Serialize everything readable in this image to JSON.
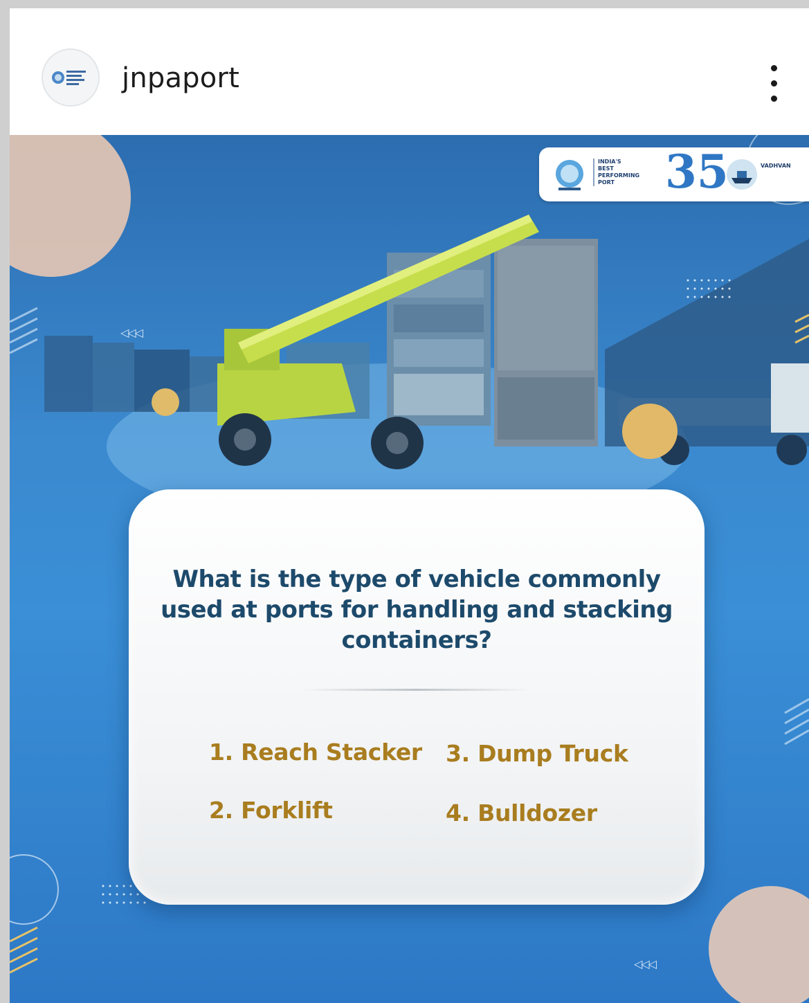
{
  "header": {
    "username": "jnpaport",
    "avatar_icon": "jnpa-logo-icon",
    "more_icon": "more-vertical-icon"
  },
  "post": {
    "logo_card": {
      "badge_lines": [
        "INDIA'S",
        "BEST",
        "PERFORMING",
        "PORT"
      ],
      "anniversary": "35",
      "vadhvan_label": "VADHVAN"
    },
    "arrows_top": "◁◁◁",
    "arrows_bottom": "◁◁◁",
    "question": "What is the type of vehicle commonly used at ports for handling and stacking containers?",
    "options": [
      "1. Reach Stacker",
      "2. Forklift",
      "3. Dump Truck",
      "4. Bulldozer"
    ]
  },
  "colors": {
    "question": "#1d4a6b",
    "option": "#a97d1f",
    "background_blue": "#3a8fd6"
  }
}
